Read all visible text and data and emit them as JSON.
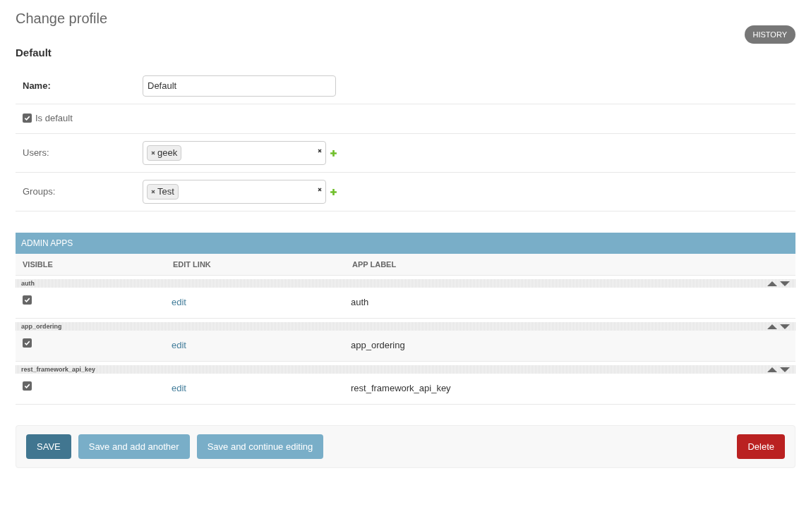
{
  "title": "Change profile",
  "history_button": "HISTORY",
  "object_name": "Default",
  "fields": [
    {
      "kind": "text",
      "label": "Name:",
      "required": true,
      "value": "Default"
    },
    {
      "kind": "checkbox",
      "label": "Is default",
      "checked": true
    },
    {
      "kind": "multiselect",
      "label": "Users:",
      "required": false,
      "tags": [
        "geek"
      ]
    },
    {
      "kind": "multiselect",
      "label": "Groups:",
      "required": false,
      "tags": [
        "Test"
      ]
    }
  ],
  "inline": {
    "title": "ADMIN APPS",
    "columns": [
      "VISIBLE",
      "EDIT LINK",
      "APP LABEL"
    ],
    "rows": [
      {
        "group": "auth",
        "visible": true,
        "link": "edit",
        "app_label": "auth"
      },
      {
        "group": "app_ordering",
        "visible": true,
        "link": "edit",
        "app_label": "app_ordering"
      },
      {
        "group": "rest_framework_api_key",
        "visible": true,
        "link": "edit",
        "app_label": "rest_framework_api_key"
      }
    ]
  },
  "buttons": [
    {
      "kind": "primary",
      "label": "SAVE"
    },
    {
      "kind": "secondary",
      "label": "Save and add another"
    },
    {
      "kind": "secondary",
      "label": "Save and continue editing"
    },
    {
      "kind": "danger",
      "label": "Delete"
    }
  ]
}
